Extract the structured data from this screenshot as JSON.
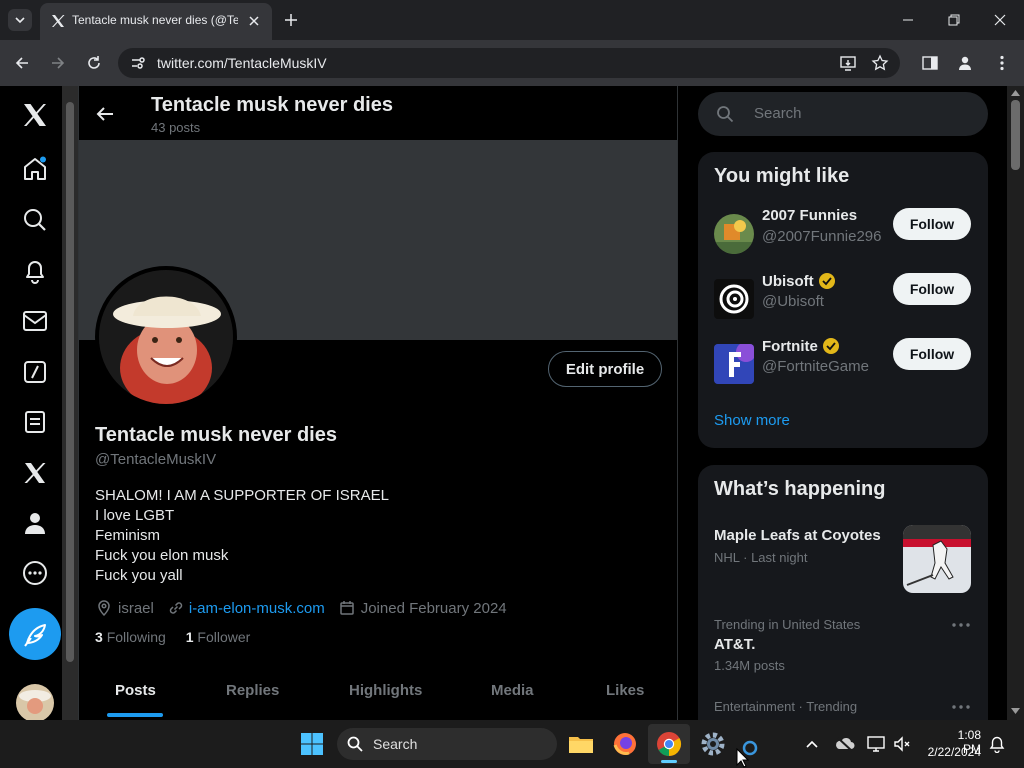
{
  "browser": {
    "tab_title": "Tentacle musk never dies (@Ten",
    "url": "twitter.com/TentacleMuskIV"
  },
  "header": {
    "name": "Tentacle musk never dies",
    "post_count": "43 posts"
  },
  "profile": {
    "edit_label": "Edit profile",
    "display_name": "Tentacle musk never dies",
    "handle": "@TentacleMuskIV",
    "bio": [
      "SHALOM! I AM A SUPPORTER OF ISRAEL",
      "I love LGBT",
      "Feminism",
      "Fuck you elon musk",
      "Fuck you yall"
    ],
    "location": "israel",
    "website": "i-am-elon-musk.com",
    "joined": "Joined February 2024",
    "following_count": "3",
    "following_label": "Following",
    "followers_count": "1",
    "followers_label": "Follower"
  },
  "tabs": [
    "Posts",
    "Replies",
    "Highlights",
    "Media",
    "Likes"
  ],
  "sidebar": {
    "search_placeholder": "Search",
    "you_might_like": {
      "title": "You might like",
      "show_more": "Show more",
      "follow_label": "Follow",
      "accounts": [
        {
          "name": "2007 Funnies",
          "handle": "@2007Funnie296",
          "verified": false
        },
        {
          "name": "Ubisoft",
          "handle": "@Ubisoft",
          "verified": true
        },
        {
          "name": "Fortnite",
          "handle": "@FortniteGame",
          "verified": true
        }
      ]
    },
    "whats_happening": {
      "title": "What’s happening",
      "event_title": "Maple Leafs at Coyotes",
      "event_meta": "NHL · Last night",
      "trend1_context": "Trending in United States",
      "trend1_name": "AT&T.",
      "trend1_count": "1.34M posts",
      "trend2_context": "Entertainment · Trending"
    }
  },
  "taskbar": {
    "search_label": "Search",
    "time": "1:08 PM",
    "date": "2/22/2024"
  },
  "colors": {
    "accent": "#1d9bf0",
    "gold": "#e2b719"
  }
}
